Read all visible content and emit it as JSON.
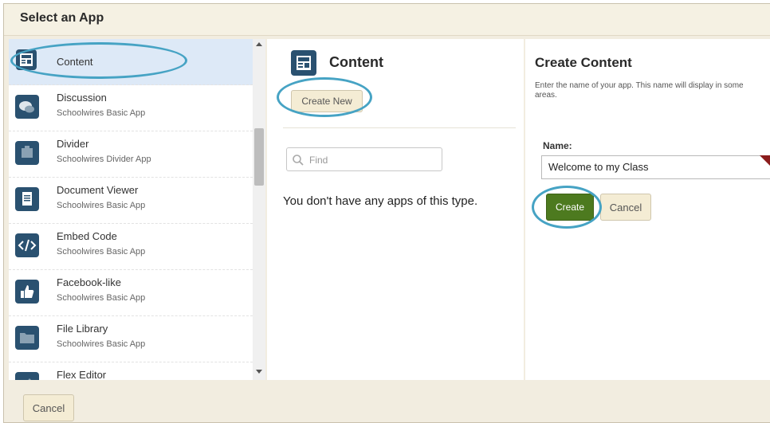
{
  "dialog": {
    "title": "Select an App"
  },
  "apps": [
    {
      "name": "Content",
      "subtitle": "",
      "icon": "content-icon",
      "selected": true
    },
    {
      "name": "Discussion",
      "subtitle": "Schoolwires Basic App",
      "icon": "discussion-icon"
    },
    {
      "name": "Divider",
      "subtitle": "Schoolwires Divider App",
      "icon": "divider-icon"
    },
    {
      "name": "Document Viewer",
      "subtitle": "Schoolwires Basic App",
      "icon": "document-icon"
    },
    {
      "name": "Embed Code",
      "subtitle": "Schoolwires Basic App",
      "icon": "code-icon"
    },
    {
      "name": "Facebook-like",
      "subtitle": "Schoolwires Basic App",
      "icon": "thumbs-up-icon"
    },
    {
      "name": "File Library",
      "subtitle": "Schoolwires Basic App",
      "icon": "folder-icon"
    },
    {
      "name": "Flex Editor",
      "subtitle": "",
      "icon": "pencil-icon"
    }
  ],
  "middle": {
    "title": "Content",
    "create_new_label": "Create New",
    "find_placeholder": "Find",
    "empty_message": "You don't have any apps of this type."
  },
  "right": {
    "title": "Create Content",
    "description": "Enter the name of your app. This name will display in some areas.",
    "name_label": "Name:",
    "name_value": "Welcome to my Class",
    "create_label": "Create",
    "cancel_label": "Cancel"
  },
  "footer": {
    "cancel_label": "Cancel"
  },
  "colors": {
    "icon": "#2a5170",
    "highlight": "#46a3c4",
    "create": "#4d7a1f",
    "selected_row": "#dde9f7"
  }
}
